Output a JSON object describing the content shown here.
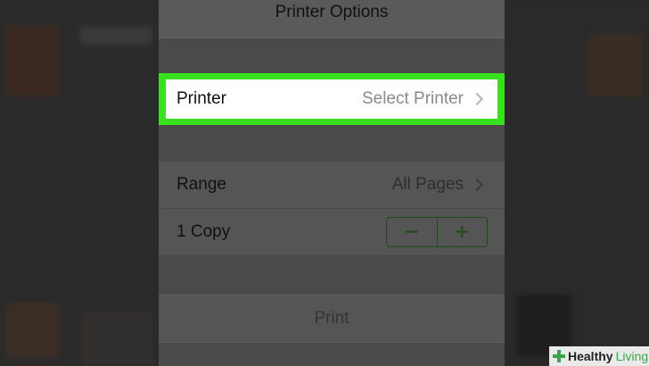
{
  "dialog": {
    "title": "Printer Options",
    "printer": {
      "label": "Printer",
      "value": "Select Printer"
    },
    "range": {
      "label": "Range",
      "value": "All Pages"
    },
    "copies": {
      "label": "1 Copy",
      "decrement": "−",
      "increment": "+"
    },
    "print_button": "Print"
  },
  "watermark": {
    "brand1": "Healthy",
    "brand2": "Living"
  },
  "colors": {
    "highlight": "#37e21d",
    "accent": "#1f4a18"
  }
}
